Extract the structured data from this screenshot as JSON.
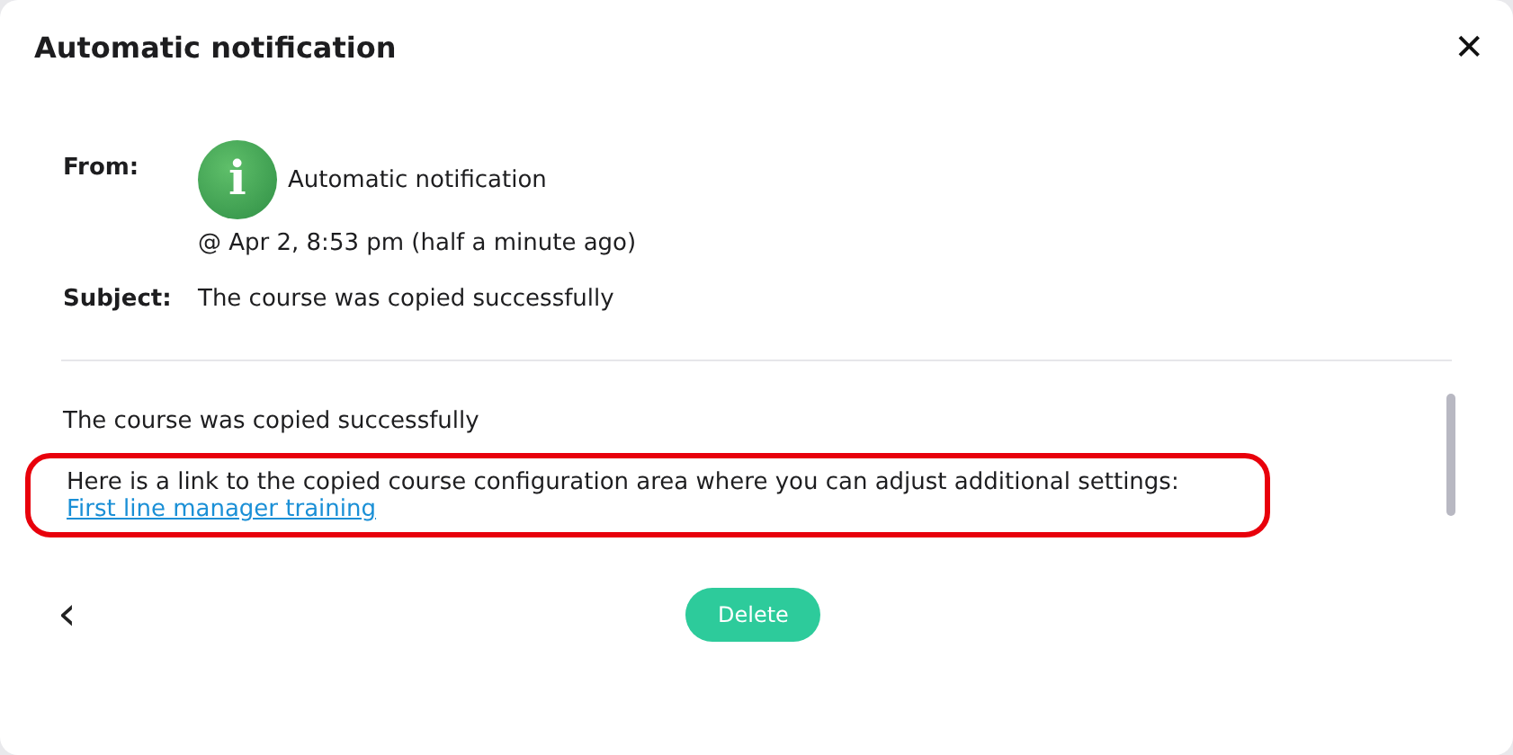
{
  "dialog": {
    "title": "Automatic notification",
    "close": "✕"
  },
  "from": {
    "label": "From:",
    "sender": "Automatic notification",
    "icon_glyph": "i",
    "time": "@ Apr 2, 8:53 pm (half a minute ago)"
  },
  "subject": {
    "label": "Subject:",
    "value": "The course was copied successfully"
  },
  "body": {
    "lead": "The course was copied successfully",
    "text": "Here is a link to the copied course configuration area where you can adjust additional settings:",
    "link": "First line manager training",
    "highlighted": true
  },
  "footer": {
    "back": "‹",
    "delete": "Delete"
  }
}
